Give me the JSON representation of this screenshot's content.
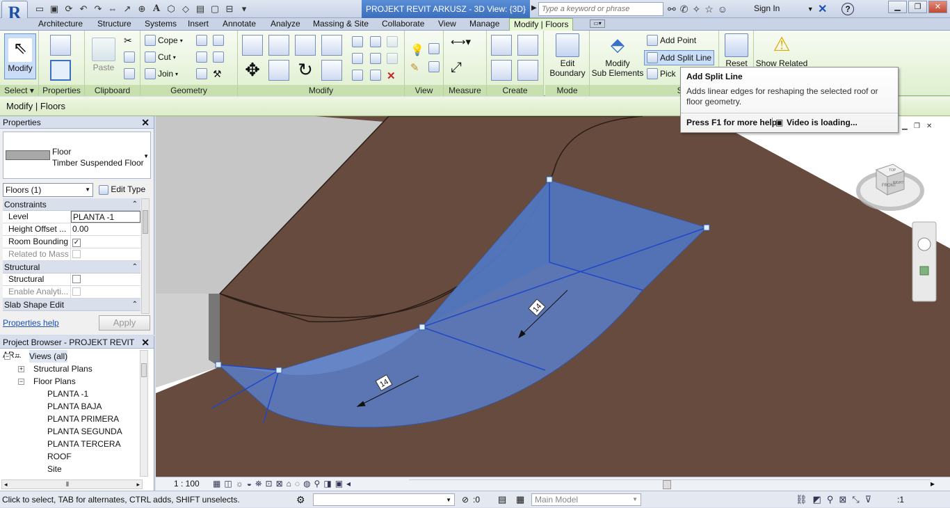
{
  "app": {
    "logo": "R",
    "title": "PROJEKT REVIT ARKUSZ - 3D View: {3D}",
    "search_placeholder": "Type a keyword or phrase",
    "sign_in": "Sign In"
  },
  "tabs": [
    "Architecture",
    "Structure",
    "Systems",
    "Insert",
    "Annotate",
    "Analyze",
    "Massing & Site",
    "Collaborate",
    "View",
    "Manage",
    "Modify | Floors"
  ],
  "active_tab": "Modify | Floors",
  "ribbon": {
    "panels": [
      "Select",
      "Properties",
      "Clipboard",
      "Geometry",
      "Modify",
      "View",
      "Measure",
      "Create",
      "Mode",
      "Shape Edi"
    ],
    "modify": "Modify",
    "paste": "Paste",
    "cope": "Cope",
    "cut": "Cut",
    "join": "Join",
    "edit_boundary_1": "Edit",
    "edit_boundary_2": "Boundary",
    "modify_sub_1": "Modify",
    "modify_sub_2": "Sub Elements",
    "add_point": "Add Point",
    "add_split_line": "Add Split Line",
    "pick": "Pick",
    "reset": "Reset",
    "show_related": "Show Related"
  },
  "options_bar": "Modify | Floors",
  "tooltip": {
    "title": "Add Split Line",
    "description": "Adds linear edges for reshaping the selected roof or floor geometry.",
    "help": "Press F1 for more help",
    "video": "Video is loading..."
  },
  "properties": {
    "title": "Properties",
    "family": "Floor",
    "type": "Timber Suspended Floor",
    "filter": "Floors (1)",
    "edit_type": "Edit Type",
    "groups": [
      {
        "name": "Constraints",
        "rows": [
          {
            "name": "Level",
            "value": "PLANTA -1"
          },
          {
            "name": "Height Offset ...",
            "value": "0.00"
          },
          {
            "name": "Room Bounding",
            "value": "✓"
          },
          {
            "name": "Related to Mass",
            "value": ""
          }
        ]
      },
      {
        "name": "Structural",
        "rows": [
          {
            "name": "Structural",
            "value": ""
          },
          {
            "name": "Enable Analyti...",
            "value": ""
          }
        ]
      },
      {
        "name": "Slab Shape Edit",
        "rows": []
      }
    ],
    "help": "Properties help",
    "apply": "Apply"
  },
  "browser": {
    "title": "Project Browser - PROJEKT REVIT AR...",
    "views_all": "Views (all)",
    "structural_plans": "Structural Plans",
    "floor_plans": "Floor Plans",
    "plans": [
      "PLANTA -1",
      "PLANTA BAJA",
      "PLANTA PRIMERA",
      "PLANTA SEGUNDA",
      "PLANTA TERCERA",
      "ROOF",
      "Site"
    ]
  },
  "viewport": {
    "slope_labels": [
      "14",
      "14"
    ],
    "viewcube_face": "FRONT",
    "viewcube_side": "RIGHT",
    "viewcube_top": "TOP"
  },
  "view_control": {
    "scale": "1 : 100"
  },
  "status": {
    "message": "Click to select, TAB for alternates, CTRL adds, SHIFT unselects.",
    "count": ":0",
    "model": "Main Model",
    "filter": ":1"
  }
}
